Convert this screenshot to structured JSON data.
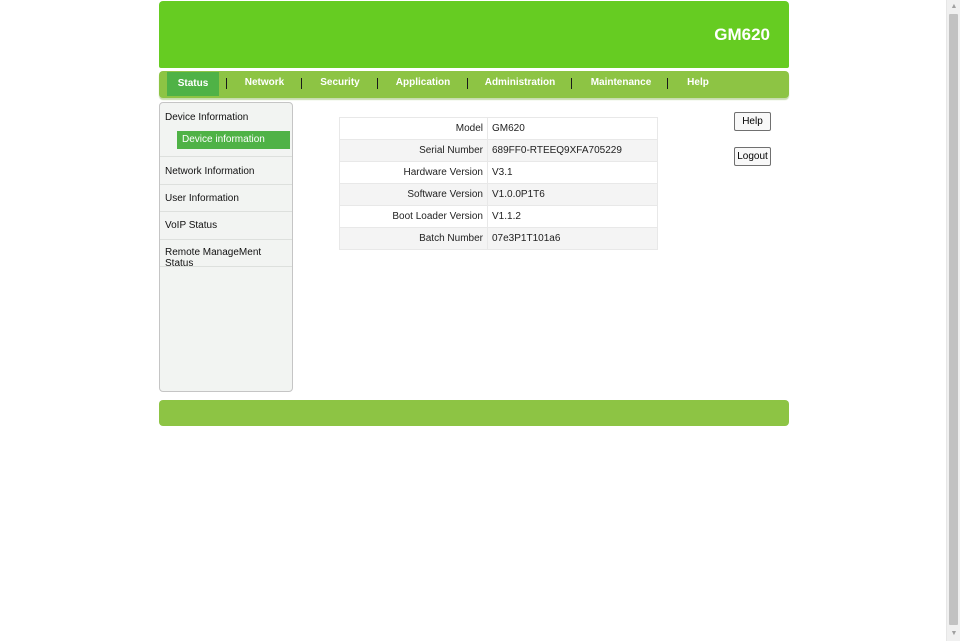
{
  "brand": "GM620",
  "nav": [
    {
      "label": "Status",
      "active": true
    },
    {
      "label": "Network"
    },
    {
      "label": "Security"
    },
    {
      "label": "Application"
    },
    {
      "label": "Administration"
    },
    {
      "label": "Maintenance"
    },
    {
      "label": "Help"
    }
  ],
  "nav_separator": "|",
  "sidebar": {
    "items": [
      {
        "label": "Device Information"
      },
      {
        "label": "Network Information"
      },
      {
        "label": "User Information"
      },
      {
        "label": "VoIP Status"
      },
      {
        "label": "Remote ManageMent Status"
      }
    ],
    "sub_item": "Device information"
  },
  "device_info": {
    "rows": [
      {
        "label": "Model",
        "value": "GM620"
      },
      {
        "label": "Serial Number",
        "value": "689FF0-RTEEQ9XFA705229"
      },
      {
        "label": "Hardware Version",
        "value": "V3.1"
      },
      {
        "label": "Software Version",
        "value": "V1.0.0P1T6"
      },
      {
        "label": "Boot Loader Version",
        "value": "V1.1.2"
      },
      {
        "label": "Batch Number",
        "value": "07e3P1T101a6"
      }
    ]
  },
  "buttons": {
    "help": "Help",
    "logout": "Logout"
  },
  "colors": {
    "header": "#66cc22",
    "nav": "#8dc444",
    "active": "#4fb246"
  }
}
